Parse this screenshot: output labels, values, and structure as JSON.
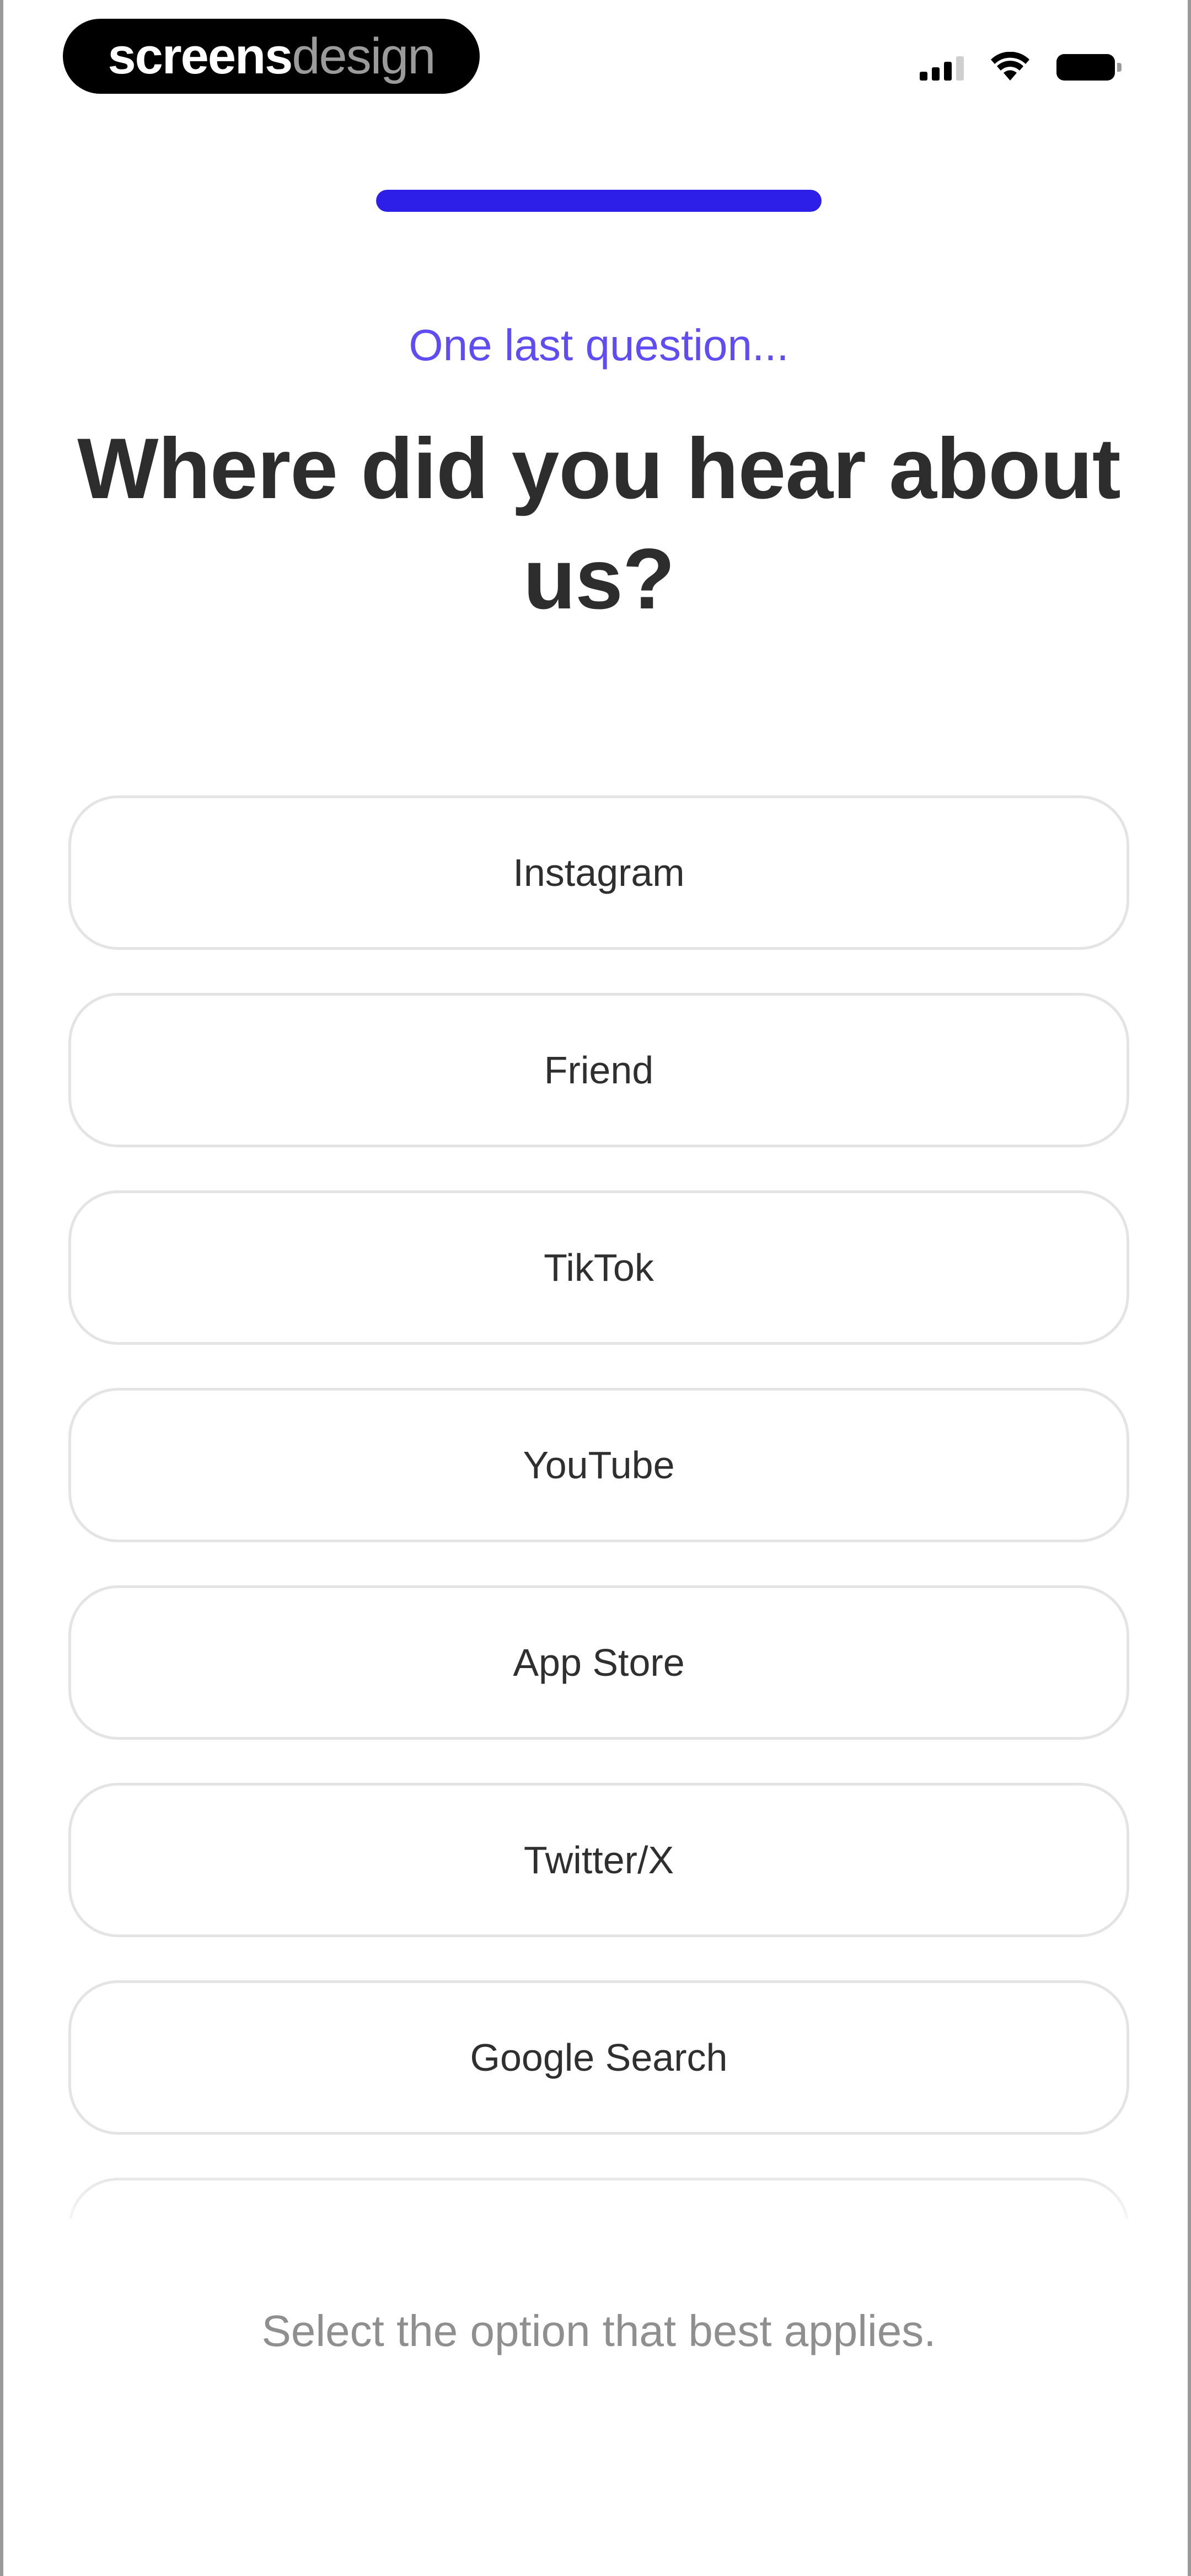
{
  "watermark": {
    "part_bold": "screens",
    "part_light": "design"
  },
  "status_bar": {
    "icons": [
      "signal-icon",
      "wifi-icon",
      "battery-icon"
    ]
  },
  "progress": {
    "fraction": 1.0,
    "color": "#2d1fe8"
  },
  "header": {
    "eyebrow": "One last question...",
    "title": "Where did you hear about us?"
  },
  "options": [
    {
      "label": "Instagram"
    },
    {
      "label": "Friend"
    },
    {
      "label": "TikTok"
    },
    {
      "label": "YouTube"
    },
    {
      "label": "App Store"
    },
    {
      "label": "Twitter/X"
    },
    {
      "label": "Google Search"
    },
    {
      "label": ""
    }
  ],
  "footer": {
    "hint": "Select the option that best applies."
  },
  "colors": {
    "accent": "#5f4cf2",
    "title": "#2d2d2d",
    "border": "#e4e4e4"
  }
}
